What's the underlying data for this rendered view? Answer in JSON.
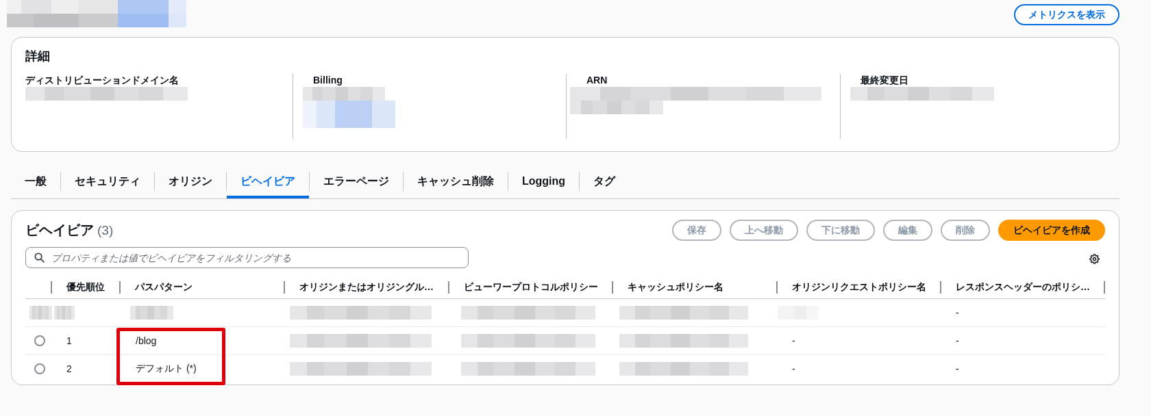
{
  "page_header": {
    "title": [
      {
        "kind": "redacted"
      },
      {
        "kind": "redacted"
      }
    ],
    "button": {
      "label": "メトリクスを表示"
    }
  },
  "details": {
    "title": "詳細",
    "fields": [
      {
        "label": "ディストリビューションドメイン名",
        "value": [
          {
            "kind": "redacted"
          }
        ]
      },
      {
        "label": "Billing",
        "value": [
          {
            "kind": "redacted"
          },
          {
            "kind": "redacted"
          },
          {
            "kind": "redacted"
          }
        ]
      },
      {
        "label": "ARN",
        "value": [
          {
            "kind": "redacted"
          },
          {
            "kind": "redacted"
          }
        ]
      },
      {
        "label": "最終変更日",
        "value": [
          {
            "kind": "redacted"
          }
        ]
      }
    ]
  },
  "tabs": [
    {
      "label": "一般",
      "selected": false
    },
    {
      "label": "セキュリティ",
      "selected": false
    },
    {
      "label": "オリジン",
      "selected": false
    },
    {
      "label": "ビヘイビア",
      "selected": true
    },
    {
      "label": "エラーページ",
      "selected": false
    },
    {
      "label": "キャッシュ削除",
      "selected": false
    },
    {
      "label": "Logging",
      "selected": false
    },
    {
      "label": "タグ",
      "selected": false
    }
  ],
  "behaviors": {
    "title": "ビヘイビア",
    "count": "(3)",
    "buttons": [
      {
        "label": "保存",
        "kind": "normal",
        "disabled": true
      },
      {
        "label": "上へ移動",
        "kind": "normal",
        "disabled": true
      },
      {
        "label": "下に移動",
        "kind": "normal",
        "disabled": true
      },
      {
        "label": "編集",
        "kind": "normal",
        "disabled": true
      },
      {
        "label": "削除",
        "kind": "normal",
        "disabled": true
      },
      {
        "label": "ビヘイビアを作成",
        "kind": "primary",
        "disabled": false
      }
    ],
    "search": {
      "placeholder": "プロパティまたは値でビヘイビアをフィルタリングする"
    },
    "table": {
      "columns": [
        "優先順位",
        "パスパターン",
        "オリジンまたはオリジングル…",
        "ビューワープロトコルポリシー",
        "キャッシュポリシー名",
        "オリジンリクエストポリシー名",
        "レスポンスヘッダーのポリシ…"
      ],
      "rows": [
        {
          "highlighted": false,
          "selector": {
            "kind": "redacted"
          },
          "cells": [
            {
              "kind": "redacted"
            },
            {
              "kind": "redacted"
            },
            {
              "kind": "redacted"
            },
            {
              "kind": "redacted"
            },
            {
              "kind": "redacted"
            },
            {
              "kind": "redacted"
            },
            {
              "kind": "text",
              "text": "-"
            }
          ]
        },
        {
          "highlighted": true,
          "selector": {
            "kind": "radio",
            "selected": false
          },
          "cells": [
            {
              "kind": "text",
              "text": "1"
            },
            {
              "kind": "text",
              "text": "/blog"
            },
            {
              "kind": "redacted"
            },
            {
              "kind": "redacted"
            },
            {
              "kind": "redacted"
            },
            {
              "kind": "text",
              "text": "-"
            },
            {
              "kind": "text",
              "text": "-"
            }
          ]
        },
        {
          "highlighted": true,
          "selector": {
            "kind": "radio",
            "selected": false
          },
          "cells": [
            {
              "kind": "text",
              "text": "2"
            },
            {
              "kind": "text",
              "text": "デフォルト (*)"
            },
            {
              "kind": "redacted"
            },
            {
              "kind": "redacted"
            },
            {
              "kind": "redacted"
            },
            {
              "kind": "text",
              "text": "-"
            },
            {
              "kind": "text",
              "text": "-"
            }
          ]
        }
      ]
    }
  }
}
